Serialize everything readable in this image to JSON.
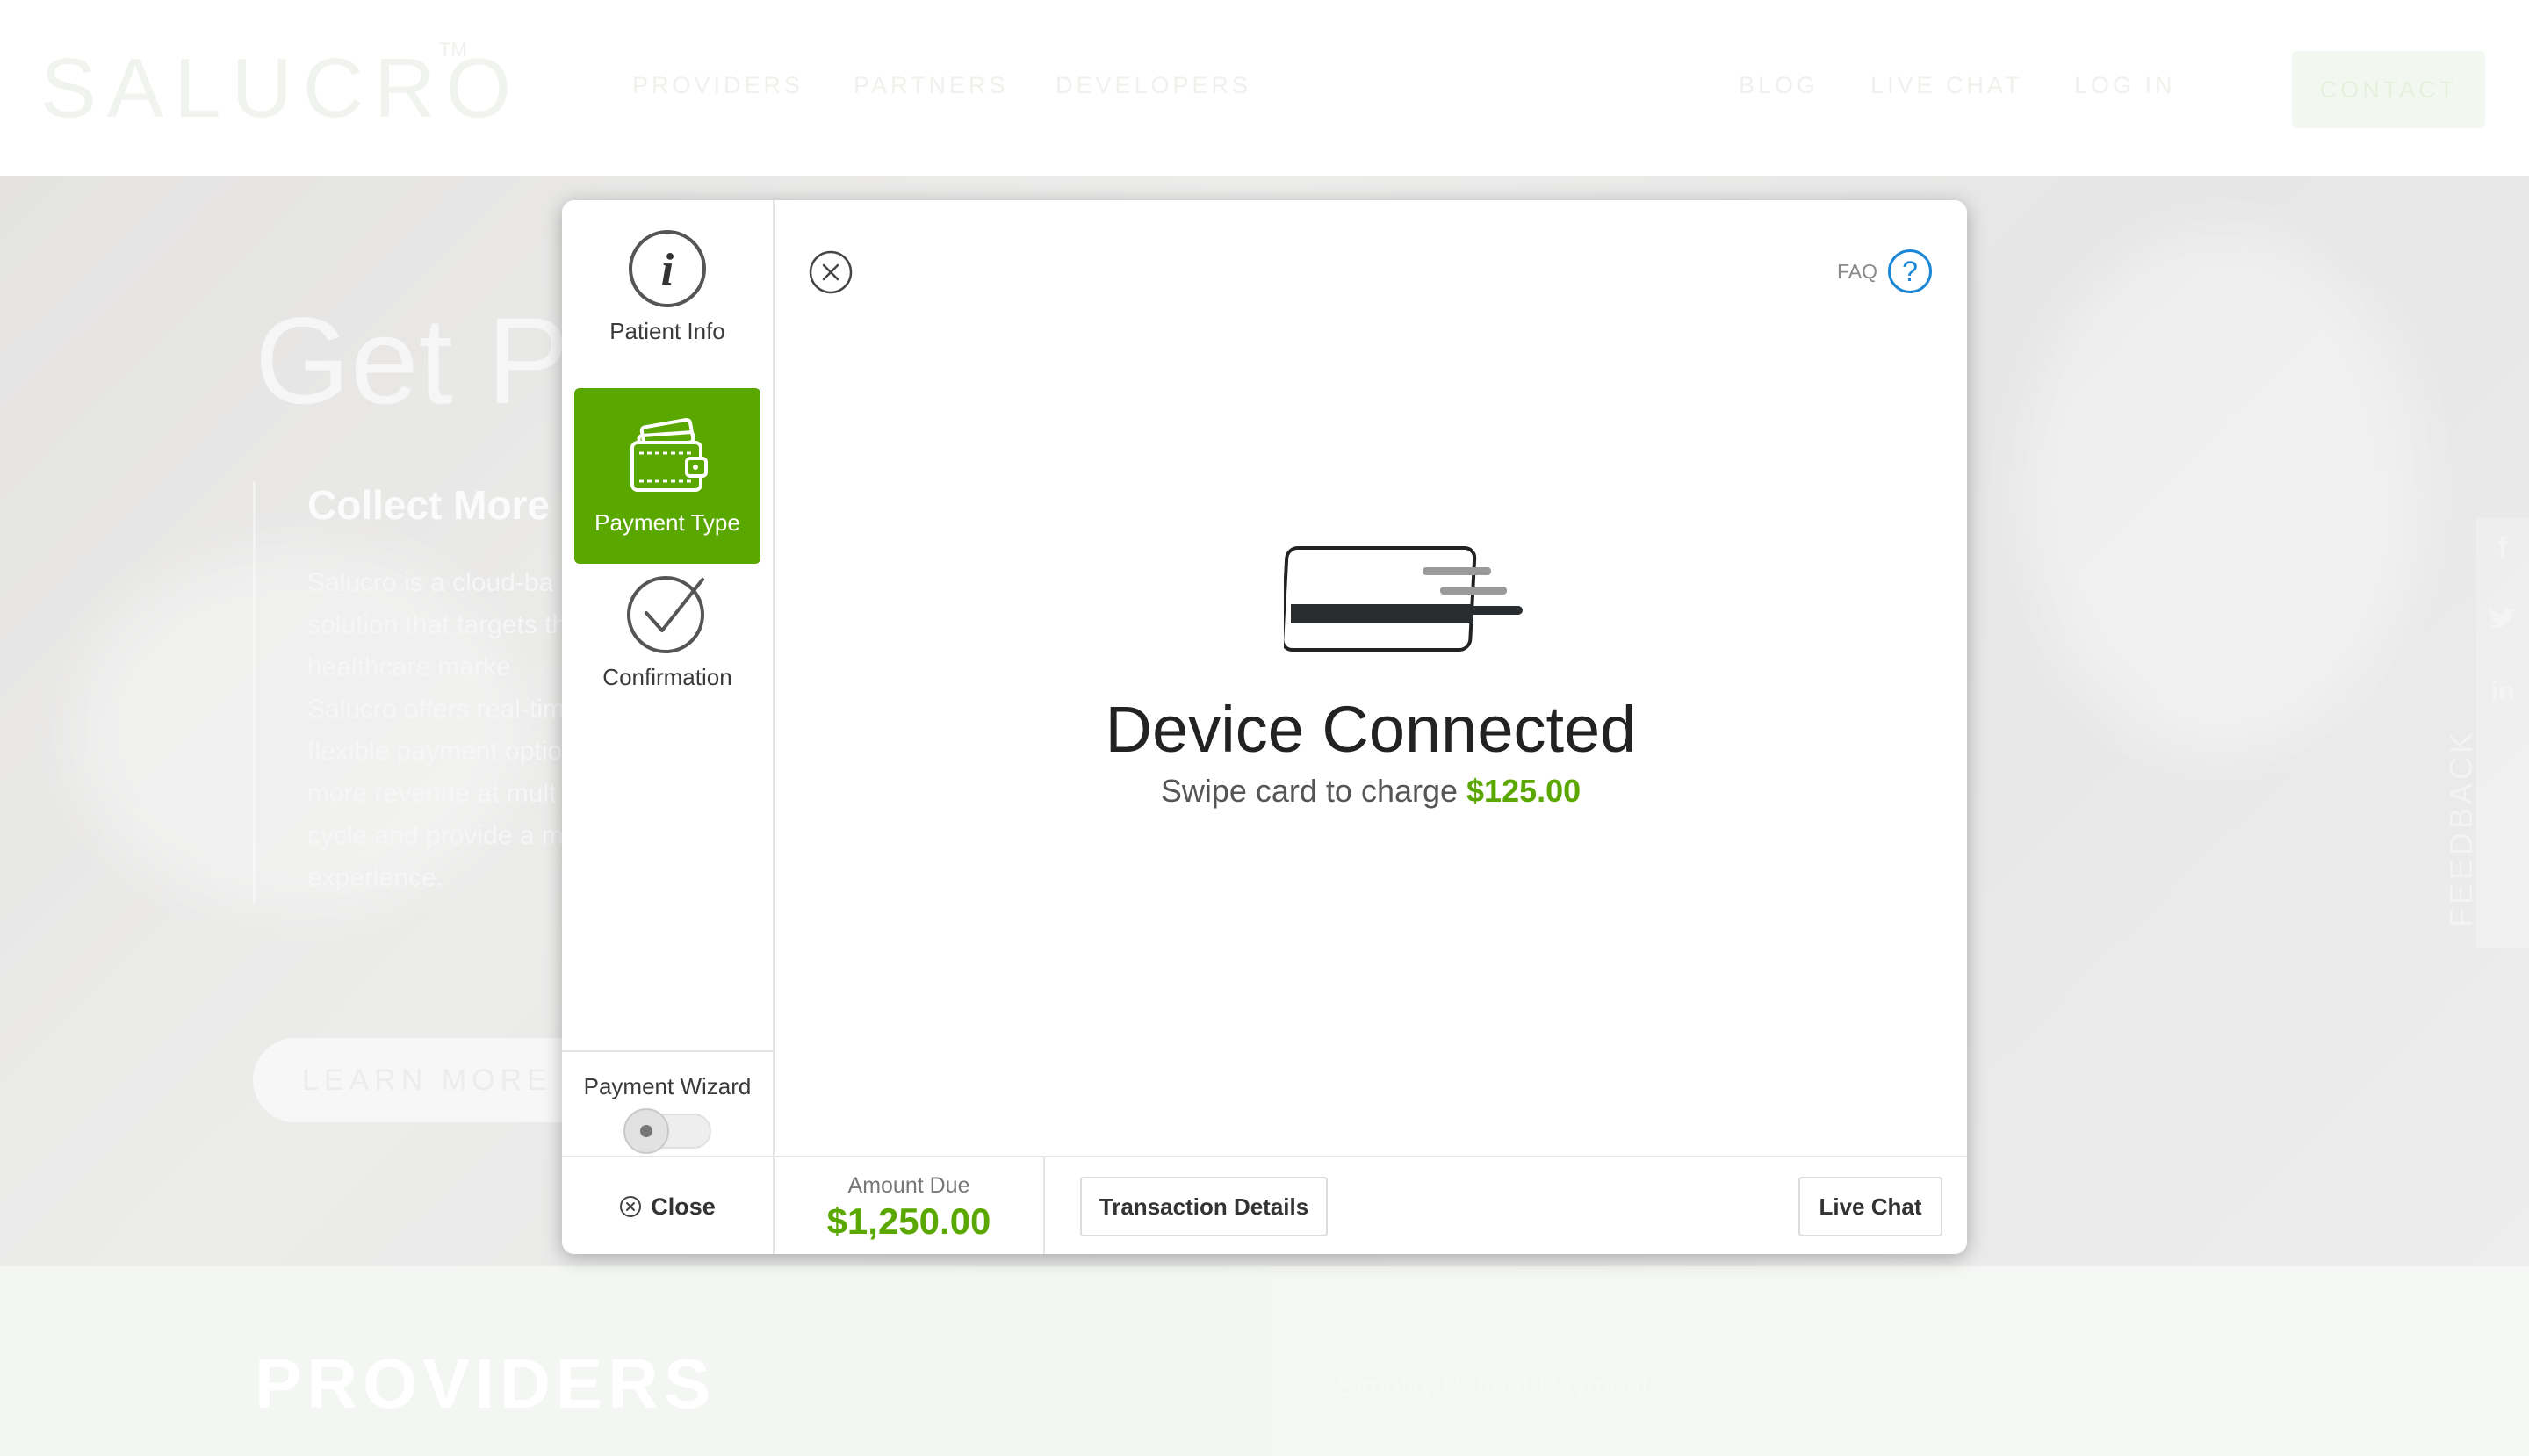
{
  "site": {
    "logo": "SALUCRO",
    "logo_tm": "TM",
    "nav_left": [
      "PROVIDERS",
      "PARTNERS",
      "DEVELOPERS"
    ],
    "nav_right": [
      "BLOG",
      "LIVE CHAT",
      "LOG IN"
    ],
    "contact_label": "CONTACT",
    "hero_title": "Get Pa",
    "hero_subtitle": "Collect More",
    "hero_body": "Salucro is a cloud-ba solution that targets the healthcare marke Salucro offers real-tim flexible payment optio more revenue at mult cycle and provide a m experience.",
    "learn_more": "LEARN MORE",
    "feedback": "FEEDBACK",
    "providers_heading": "PROVIDERS",
    "simplify": "Simplify Patient Payments",
    "social_icons": [
      "facebook-icon",
      "twitter-icon",
      "linkedin-icon"
    ]
  },
  "wizard": {
    "steps": [
      {
        "label": "Patient Info",
        "icon": "info-icon",
        "active": false
      },
      {
        "label": "Payment Type",
        "icon": "wallet-icon",
        "active": true
      },
      {
        "label": "Confirmation",
        "icon": "checkmark-icon",
        "active": false
      }
    ],
    "toggle_label": "Payment Wizard",
    "toggle_on": false
  },
  "main": {
    "faq_label": "FAQ",
    "faq_icon": "?",
    "title": "Device Connected",
    "subtitle_prefix": "Swipe card to charge",
    "charge_amount": "$125.00"
  },
  "footer": {
    "close_label": "Close",
    "amount_due_label": "Amount Due",
    "amount_due_value": "$1,250.00",
    "transaction_details_label": "Transaction Details",
    "live_chat_label": "Live Chat"
  },
  "colors": {
    "accent_green": "#5aa700",
    "faq_blue": "#1a86d6"
  }
}
